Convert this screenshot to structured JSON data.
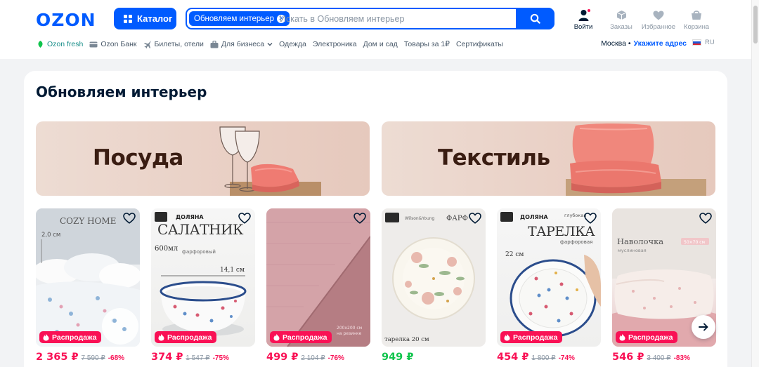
{
  "brand": {
    "logo": "OZON",
    "accent": "#005bff",
    "sale_color": "#f91155",
    "price_green": "#10c44c"
  },
  "header": {
    "catalog_label": "Каталог",
    "search": {
      "chip": "Обновляем интерьер",
      "placeholder": "Искать в Обновляем интерьер"
    },
    "actions": [
      {
        "label": "Войти",
        "icon": "user-icon"
      },
      {
        "label": "Заказы",
        "icon": "box-icon"
      },
      {
        "label": "Избранное",
        "icon": "heart-icon"
      },
      {
        "label": "Корзина",
        "icon": "cart-icon"
      }
    ]
  },
  "nav": {
    "items": [
      {
        "label": "Ozon fresh",
        "icon": "fresh-icon"
      },
      {
        "label": "Ozon Банк",
        "icon": "card-icon"
      },
      {
        "label": "Билеты, отели",
        "icon": "plane-icon"
      },
      {
        "label": "Для бизнеса",
        "icon": "briefcase-icon"
      },
      {
        "label": "Одежда"
      },
      {
        "label": "Электроника"
      },
      {
        "label": "Дом и сад"
      },
      {
        "label": "Товары за 1₽"
      },
      {
        "label": "Сертификаты"
      }
    ],
    "city": "Москва •",
    "address": "Укажите адрес",
    "lang": "RU"
  },
  "section": {
    "title": "Обновляем интерьер",
    "banners": [
      {
        "label": "Посуда"
      },
      {
        "label": "Текстиль"
      }
    ],
    "sale_label": "Распродажа",
    "products": [
      {
        "price": "2 365 ₽",
        "old_price": "7 590 ₽",
        "discount": "-68%",
        "sale": true,
        "caption": "COZY HOME"
      },
      {
        "price": "374 ₽",
        "old_price": "1 547 ₽",
        "discount": "-75%",
        "sale": true,
        "caption": "САЛАТНИК"
      },
      {
        "price": "499 ₽",
        "old_price": "2 104 ₽",
        "discount": "-76%",
        "sale": true,
        "caption": ""
      },
      {
        "price": "949 ₽",
        "old_price": "",
        "discount": "",
        "sale": false,
        "caption": "тарелка 20 см"
      },
      {
        "price": "454 ₽",
        "old_price": "1 800 ₽",
        "discount": "-74%",
        "sale": true,
        "caption": "ТАРЕЛКА"
      },
      {
        "price": "546 ₽",
        "old_price": "3 400 ₽",
        "discount": "-83%",
        "sale": true,
        "caption": "Наволочка"
      }
    ]
  }
}
